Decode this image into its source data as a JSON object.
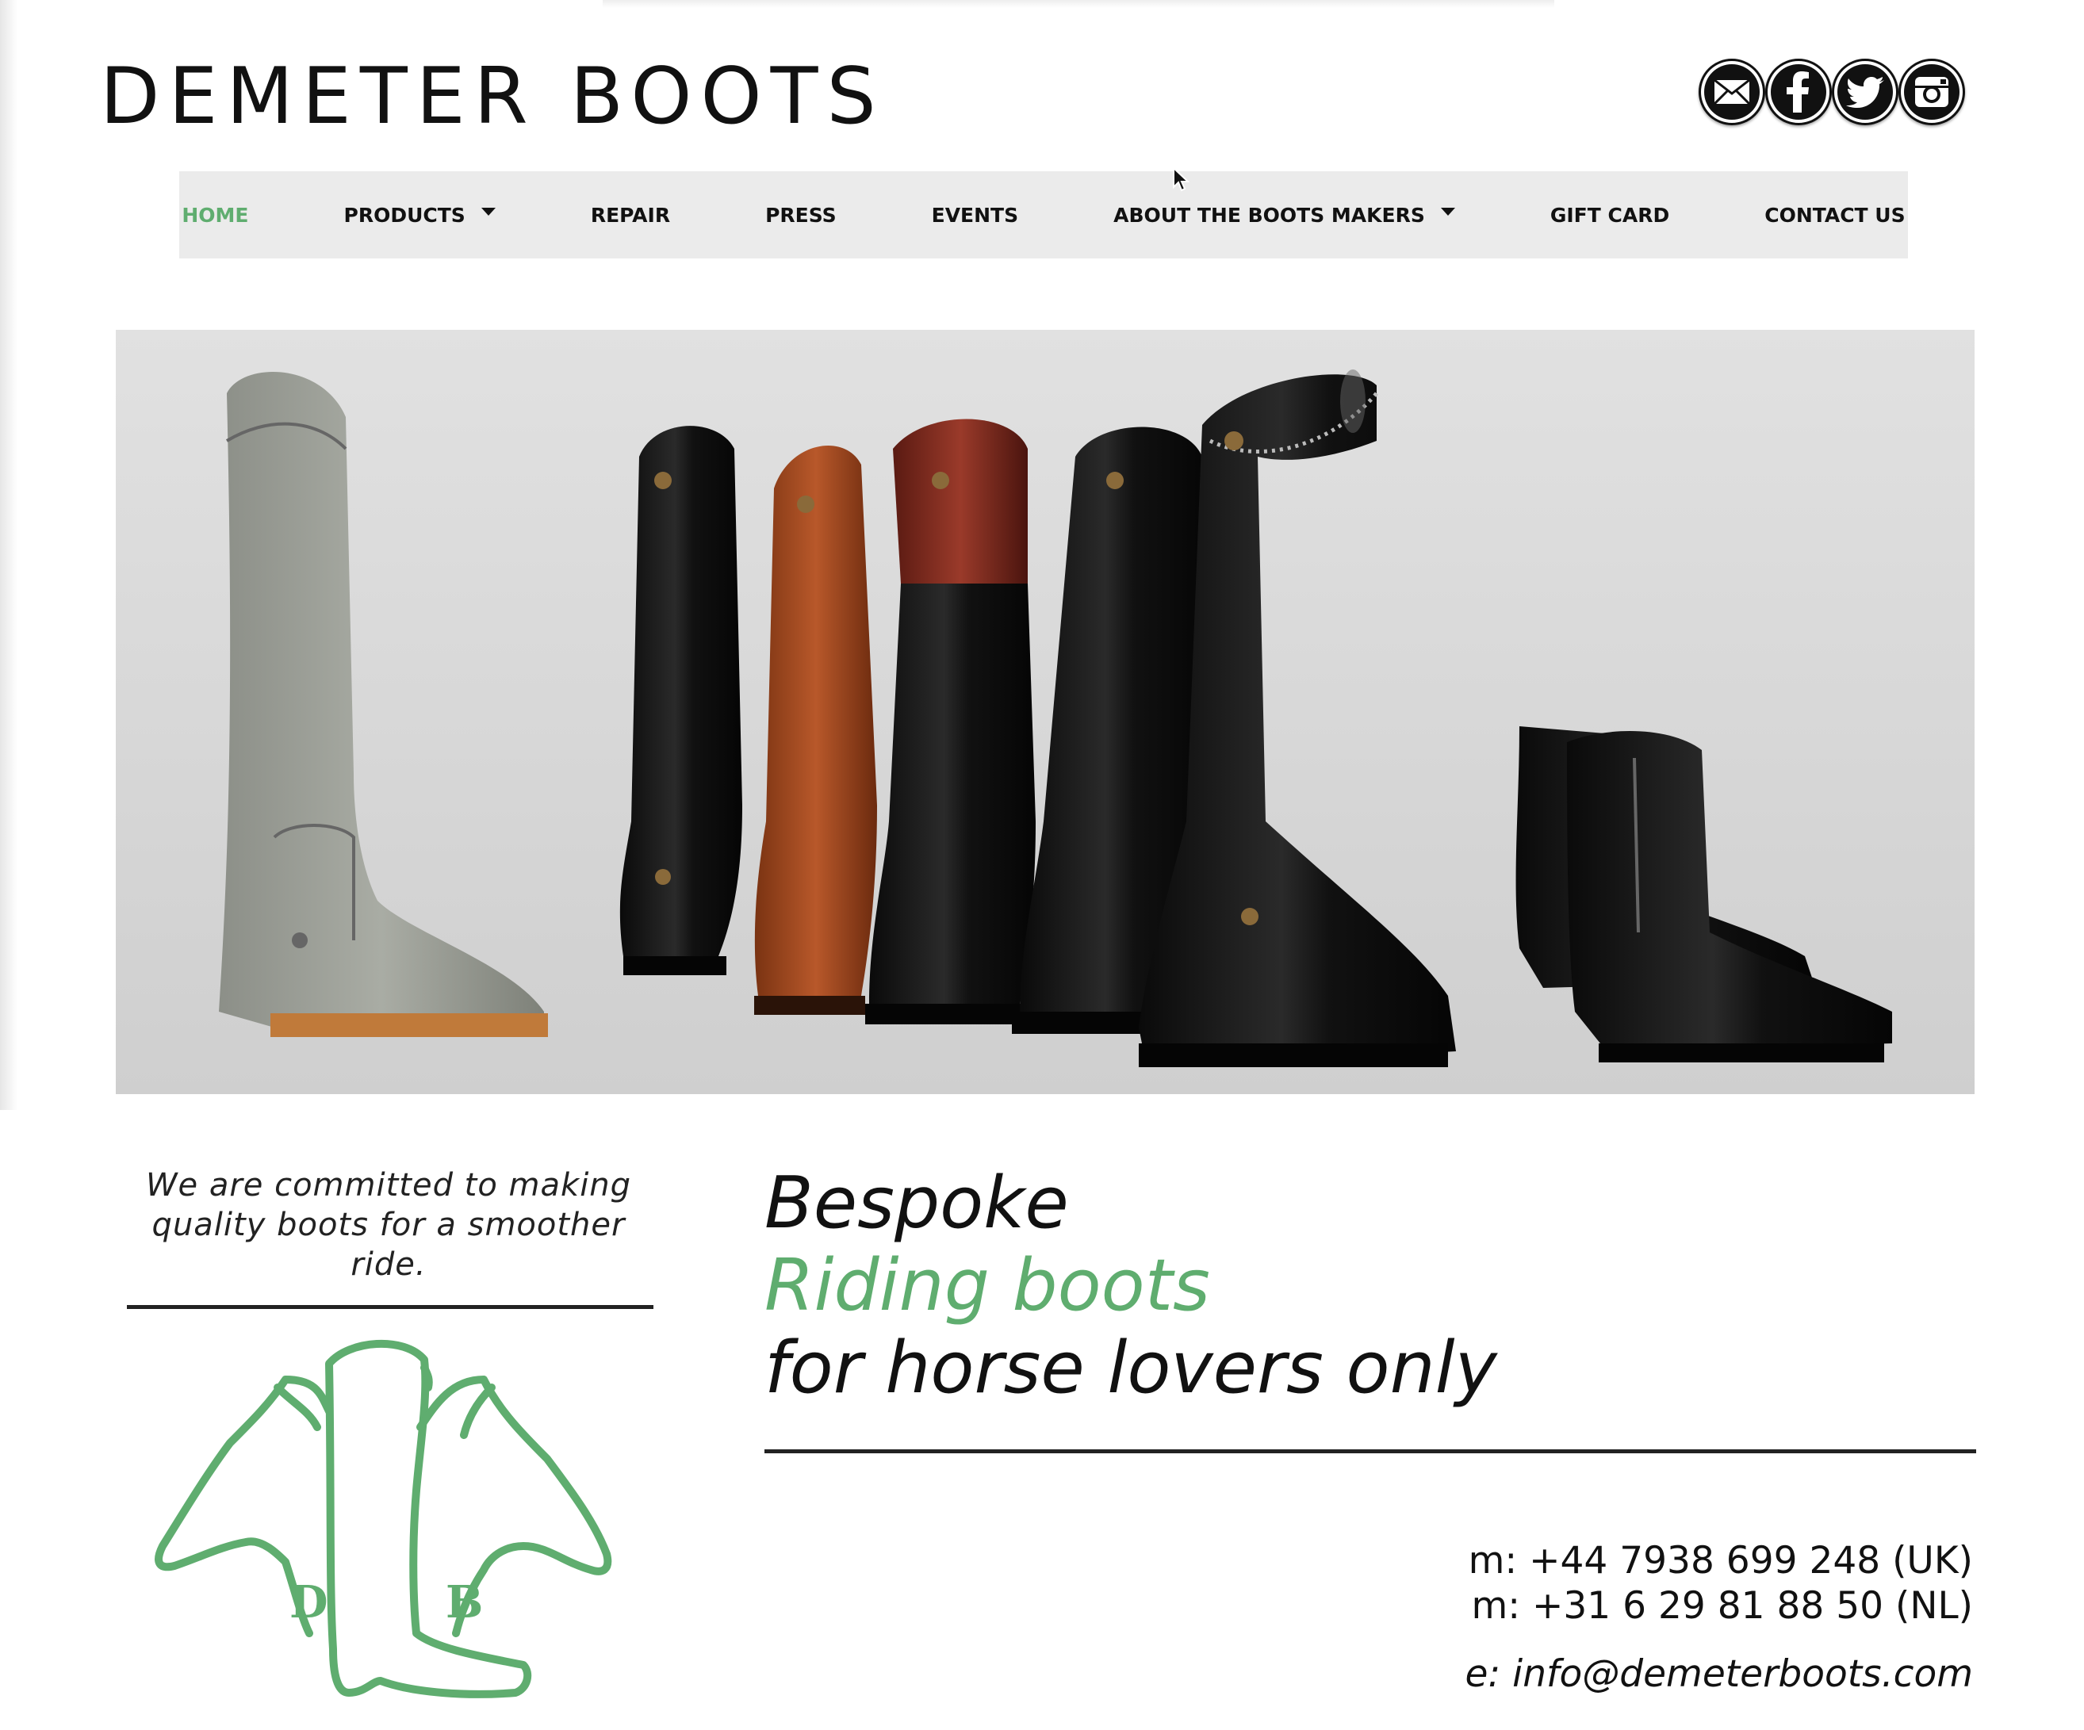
{
  "header": {
    "site_title": "DEMETER BOOTS",
    "social": [
      {
        "icon": "mail-icon",
        "label": "Email"
      },
      {
        "icon": "facebook-icon",
        "label": "Facebook"
      },
      {
        "icon": "twitter-icon",
        "label": "Twitter"
      },
      {
        "icon": "instagram-icon",
        "label": "Instagram"
      }
    ]
  },
  "nav": {
    "items": [
      {
        "label": "HOME",
        "active": true
      },
      {
        "label": "PRODUCTS",
        "dropdown": true
      },
      {
        "label": "REPAIR"
      },
      {
        "label": "PRESS"
      },
      {
        "label": "EVENTS"
      },
      {
        "label": "ABOUT THE BOOTS MAKERS",
        "dropdown": true
      },
      {
        "label": "GIFT CARD"
      },
      {
        "label": "CONTACT US"
      }
    ]
  },
  "hero": {
    "description": "Photo of riding boots"
  },
  "tagline": "We are committed to making quality boots for a smoother ride.",
  "logo": {
    "letter_left": "D",
    "letter_right": "B"
  },
  "headline": {
    "line1": "Bespoke",
    "line2": "Riding boots",
    "line3": "for horse lovers only"
  },
  "contact": {
    "phone_uk": "m: +44 7938 699 248 (UK)",
    "phone_nl": "m: +31 6 29 81 88 50 (NL)",
    "email": "e: info@demeterboots.com"
  },
  "colors": {
    "accent": "#5fad6f",
    "nav_bg": "#ebebeb",
    "text": "#111111"
  }
}
